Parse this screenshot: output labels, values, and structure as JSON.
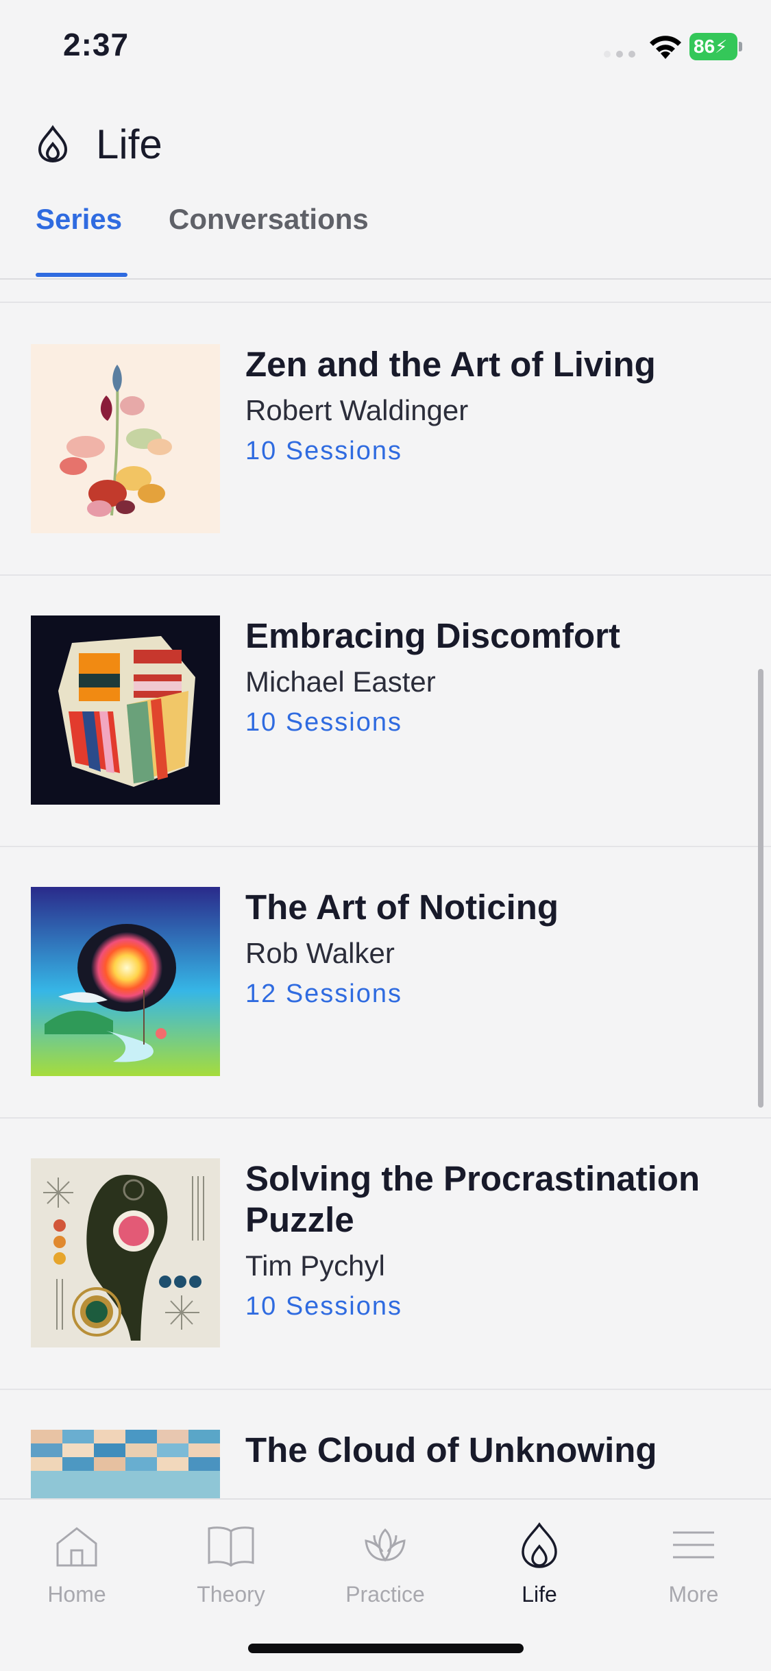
{
  "status_bar": {
    "time": "2:37",
    "battery": "86"
  },
  "header": {
    "title": "Life"
  },
  "tabs": [
    {
      "label": "Series",
      "active": true
    },
    {
      "label": "Conversations",
      "active": false
    }
  ],
  "series": [
    {
      "title": "Zen and the Art of Living",
      "author": "Robert Waldinger",
      "sessions": "10 Sessions"
    },
    {
      "title": "Embracing Discomfort",
      "author": "Michael Easter",
      "sessions": "10 Sessions"
    },
    {
      "title": "The Art of Noticing",
      "author": "Rob Walker",
      "sessions": "12 Sessions"
    },
    {
      "title": "Solving the Procrastination Puzzle",
      "author": "Tim Pychyl",
      "sessions": "10 Sessions"
    },
    {
      "title": "The Cloud of Unknowing",
      "author": "",
      "sessions": ""
    }
  ],
  "tabbar": [
    {
      "label": "Home",
      "icon": "home-icon"
    },
    {
      "label": "Theory",
      "icon": "book-icon"
    },
    {
      "label": "Practice",
      "icon": "lotus-icon"
    },
    {
      "label": "Life",
      "icon": "flame-icon",
      "active": true
    },
    {
      "label": "More",
      "icon": "menu-icon"
    }
  ],
  "colors": {
    "accent": "#2f6be0",
    "background": "#f4f4f5",
    "text": "#181a2a",
    "battery": "#34c759"
  }
}
